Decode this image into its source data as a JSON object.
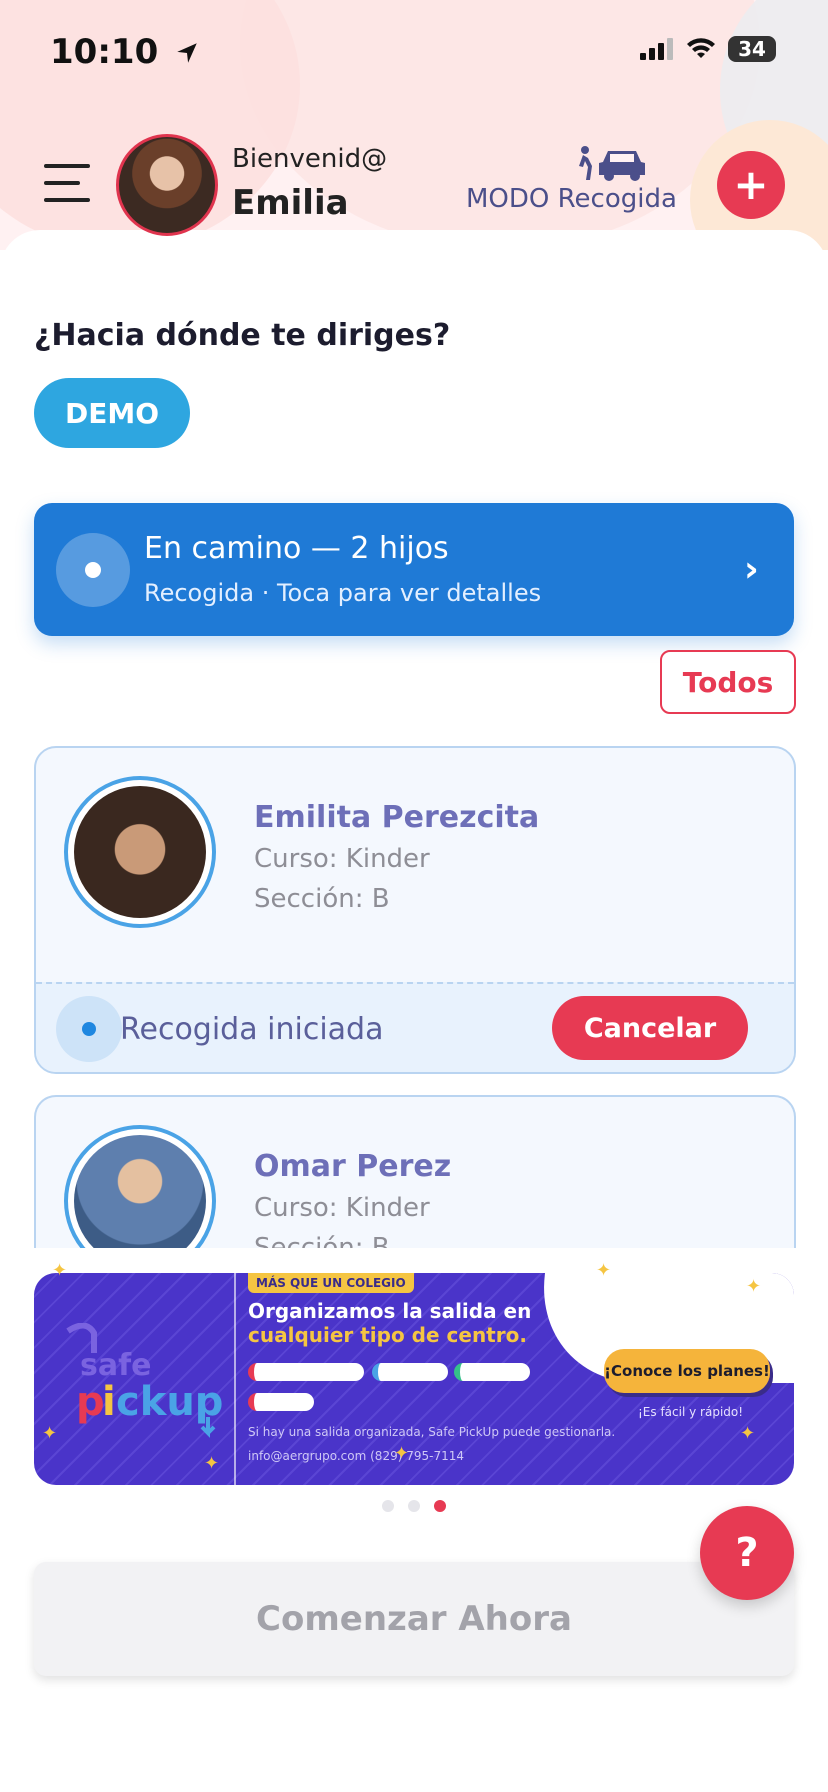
{
  "status_bar": {
    "time": "10:10",
    "battery": "34"
  },
  "header": {
    "greeting": "Bienvenid@",
    "user_name": "Emilia",
    "mode_label": "MODO Recogida",
    "add_symbol": "+"
  },
  "destination": {
    "question": "¿Hacia dónde te diriges?",
    "option": "DEMO"
  },
  "enroute": {
    "title": "En camino — 2 hijos",
    "subtitle": "Recogida · Toca para ver detalles",
    "chevron": "›"
  },
  "filter": {
    "label": "Todos"
  },
  "students": [
    {
      "name": "Emilita Perezcita",
      "course": "Curso: Kinder",
      "section": "Sección: B",
      "pickup_status": "Recogida iniciada",
      "cancel_label": "Cancelar"
    },
    {
      "name": "Omar Perez",
      "course": "Curso: Kinder",
      "section": "Sección: B"
    }
  ],
  "promo": {
    "tag": "MÁS QUE UN COLEGIO",
    "title_line1": "Organizamos la salida en",
    "title_line2": "cualquier tipo de centro.",
    "logo_top": "safe",
    "logo_bottom": "pickup",
    "small_text": "Si hay una salida organizada, Safe PickUp puede gestionarla.",
    "contact": "info@aergrupo.com    (829) 795-7114",
    "cta": "¡Conoce los planes!",
    "cta_sub": "¡Es fácil y rápido!"
  },
  "carousel": {
    "count": 3,
    "active_index": 2
  },
  "help": {
    "symbol": "?"
  },
  "start": {
    "label": "Comenzar Ahora"
  },
  "colors": {
    "accent_red": "#e73a53",
    "primary_blue": "#1f7ad6",
    "demo_blue": "#2ea6e0",
    "name_purple": "#6d6fb8",
    "promo_purple": "#4a34c9",
    "promo_yellow": "#f5c542"
  }
}
